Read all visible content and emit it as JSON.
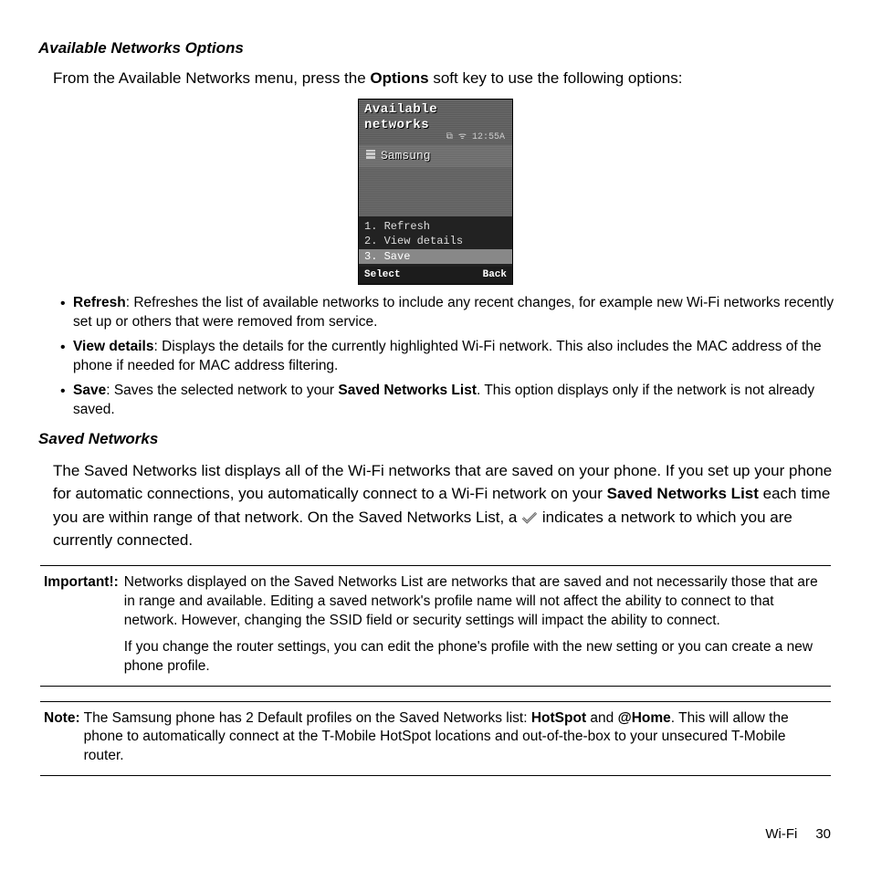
{
  "sections": {
    "avail_options_heading": "Available Networks Options",
    "saved_heading": "Saved Networks"
  },
  "lead": {
    "pre": "From the Available Networks menu, press the ",
    "softkey": "Options",
    "post": " soft key to use the following options:"
  },
  "phone": {
    "title": "Available networks",
    "clock": "12:55A",
    "network_item": "Samsung",
    "menu": {
      "item1": "1. Refresh",
      "item2": "2. View details",
      "item3": "3. Save"
    },
    "soft_left": "Select",
    "soft_right": "Back"
  },
  "options": {
    "refresh": {
      "label": "Refresh",
      "desc": ": Refreshes the list of available networks to include any recent changes, for example new Wi-Fi networks recently set up or others that were removed from service."
    },
    "view": {
      "label": "View details",
      "desc": ": Displays the details for the currently highlighted Wi-Fi network. This also includes the MAC address of the phone if needed for MAC address filtering."
    },
    "save": {
      "label": "Save",
      "desc_pre": ": Saves the selected network to your ",
      "desc_bold": "Saved Networks List",
      "desc_post": ". This option displays only if the network is not already saved."
    }
  },
  "saved_para": {
    "p1_pre": "The Saved Networks list displays all of the Wi-Fi networks that are saved on your phone. If you set up your phone for automatic connections, you automatically connect to a Wi-Fi network on your ",
    "p1_bold": "Saved Networks List",
    "p1_mid": " each time you are within range of that network. On the Saved Networks List, a ",
    "p1_post": " indicates a network to which you are currently connected."
  },
  "important": {
    "label": "Important!:",
    "p1": "Networks displayed on the Saved Networks List are networks that are saved and not necessarily those that are in range and available. Editing a saved network's profile name will not affect the ability to connect to that network. However, changing the SSID field or security settings will impact the ability to connect.",
    "p2": "If you change the router settings, you can edit the phone's profile with the new setting or you can create a new phone profile."
  },
  "note": {
    "label": "Note:",
    "pre": " The Samsung phone has 2 Default profiles on the Saved Networks list: ",
    "b1": "HotSpot",
    "mid": " and ",
    "b2": "@Home",
    "post": ". This will allow the phone to automatically connect at the T-Mobile HotSpot locations and out-of-the-box to your unsecured T-Mobile router."
  },
  "footer": {
    "section": "Wi-Fi",
    "page": "30"
  }
}
